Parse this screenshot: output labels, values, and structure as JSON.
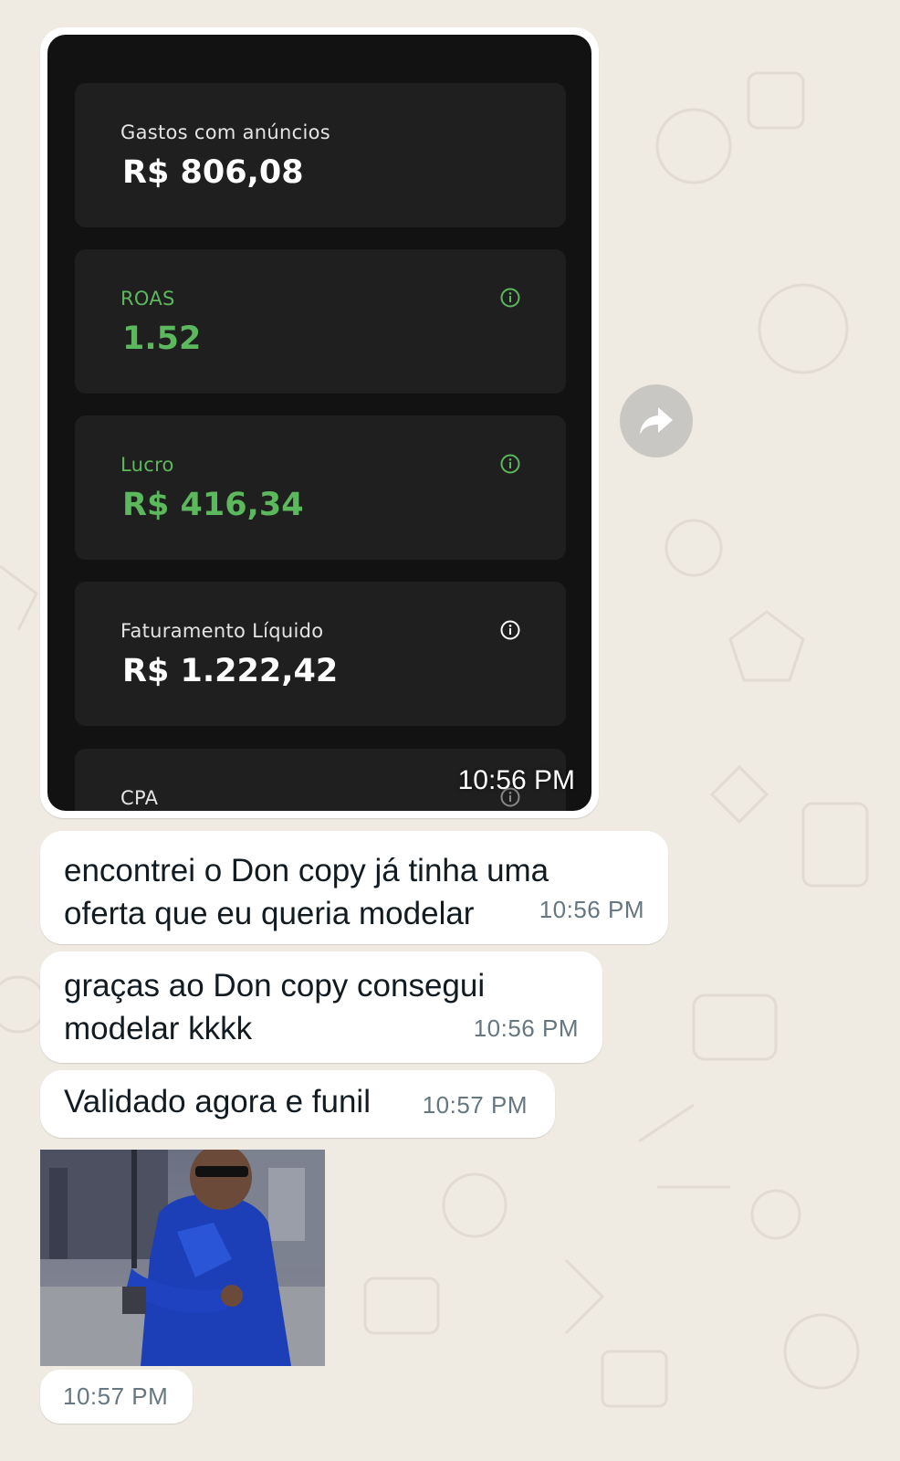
{
  "screenshot": {
    "cards": [
      {
        "label": "Gastos com anúncios",
        "value": "R$ 806,08",
        "accent": "white",
        "info_icon": false
      },
      {
        "label": "ROAS",
        "value": "1.52",
        "accent": "#5cb85c",
        "info_icon": true
      },
      {
        "label": "Lucro",
        "value": "R$ 416,34",
        "accent": "#5cb85c",
        "info_icon": true
      },
      {
        "label": "Faturamento Líquido",
        "value": "R$ 1.222,42",
        "accent": "white",
        "info_icon": true
      },
      {
        "label": "CPA",
        "value": "",
        "accent": "white",
        "info_icon": true
      }
    ],
    "time": "10:56 PM"
  },
  "messages": [
    {
      "line1": "encontrei o Don copy já tinha uma",
      "line2": "oferta que eu queria modelar",
      "time": "10:56 PM"
    },
    {
      "line1": "graças ao Don copy consegui",
      "line2": "modelar kkkk",
      "time": "10:56 PM"
    },
    {
      "text": "Validado agora e funil",
      "time": "10:57 PM"
    }
  ],
  "photo_message": {
    "time": "10:57 PM"
  },
  "colors": {
    "background": "#efeae2",
    "bubble": "#ffffff",
    "positive": "#5cb85c",
    "timestamp": "#667781"
  },
  "icons": {
    "forward": "forward-arrow-icon",
    "info": "info-icon"
  }
}
